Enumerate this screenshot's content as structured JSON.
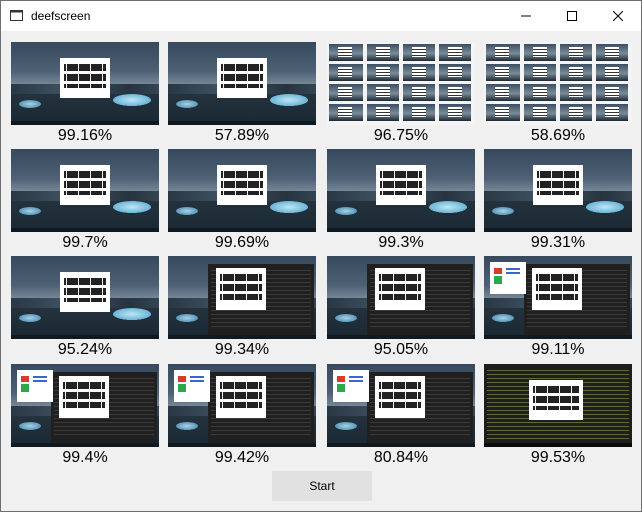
{
  "window": {
    "title": "deefscreen"
  },
  "controls": {
    "minimize_icon": "minimize-icon",
    "maximize_icon": "maximize-icon",
    "close_icon": "close-icon"
  },
  "thumbnails": [
    {
      "percent": "99.16%"
    },
    {
      "percent": "57.89%"
    },
    {
      "percent": "96.75%"
    },
    {
      "percent": "58.69%"
    },
    {
      "percent": "99.7%"
    },
    {
      "percent": "99.69%"
    },
    {
      "percent": "99.3%"
    },
    {
      "percent": "99.31%"
    },
    {
      "percent": "95.24%"
    },
    {
      "percent": "99.34%"
    },
    {
      "percent": "95.05%"
    },
    {
      "percent": "99.11%"
    },
    {
      "percent": "99.4%"
    },
    {
      "percent": "99.42%"
    },
    {
      "percent": "80.84%"
    },
    {
      "percent": "99.53%"
    }
  ],
  "start_button": {
    "label": "Start"
  }
}
